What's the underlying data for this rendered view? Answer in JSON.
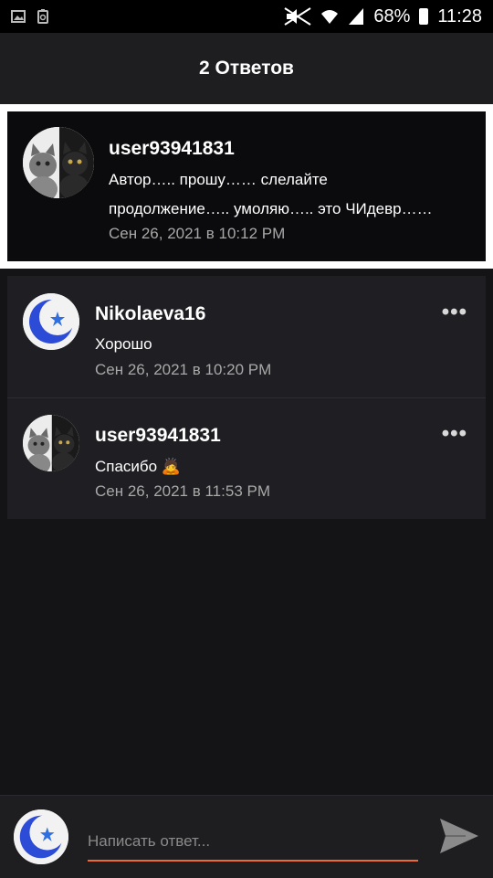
{
  "status_bar": {
    "battery": "68%",
    "time": "11:28"
  },
  "header": {
    "title": "2 Ответов"
  },
  "original_comment": {
    "username": "user93941831",
    "text_line1": "Автор….. прошу…… слелайте",
    "text_line2": "продолжение….. умоляю….. это ЧИдевр……",
    "date": "Сен 26, 2021 в 10:12 PM"
  },
  "replies": [
    {
      "username": "Nikolaeva16",
      "text": "Хорошо",
      "date": "Сен 26, 2021 в 10:20 PM",
      "more": "•••"
    },
    {
      "username": "user93941831",
      "text": "Спасибо 🙇",
      "date": "Сен 26, 2021 в 11:53 PM",
      "more": "•••"
    }
  ],
  "reply_input": {
    "placeholder": "Написать ответ..."
  },
  "colors": {
    "accent": "#ee6a34",
    "background": "#141316",
    "card": "#1f1e22"
  }
}
